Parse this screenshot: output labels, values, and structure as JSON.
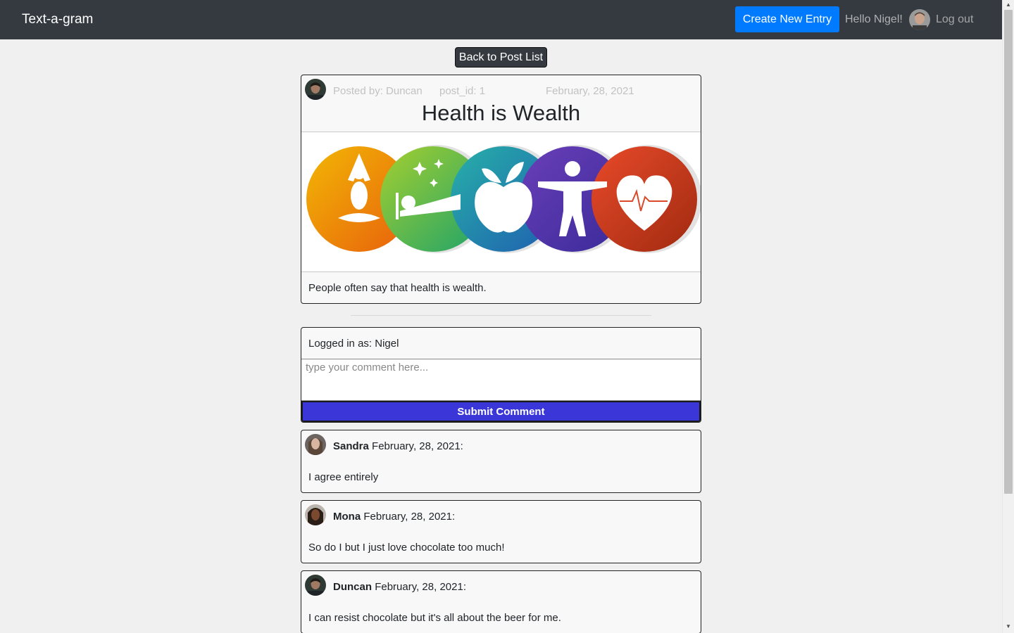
{
  "navbar": {
    "brand": "Text-a-gram",
    "new_entry_label": "Create New Entry",
    "greeting": "Hello Nigel!",
    "logout_label": "Log out"
  },
  "back_button_label": "Back to Post List",
  "post": {
    "author_label": "Posted by: Duncan",
    "post_id_label": "post_id: 1",
    "date": "February, 28, 2021",
    "title": "Health is Wealth",
    "body": "People often say that health is wealth."
  },
  "comment_form": {
    "logged_in_label": "Logged in as: Nigel",
    "placeholder": "type your comment here...",
    "submit_label": "Submit Comment"
  },
  "comments": [
    {
      "author": "Sandra",
      "date": "February, 28, 2021:",
      "text": "I agree entirely"
    },
    {
      "author": "Mona",
      "date": "February, 28, 2021:",
      "text": "So do I but I just love chocolate too much!"
    },
    {
      "author": "Duncan",
      "date": "February, 28, 2021:",
      "text": "I can resist chocolate but it's all about the beer for me."
    }
  ],
  "colors": {
    "navbar_bg": "#343a40",
    "primary": "#007bff",
    "submit_bg": "#3a36d8",
    "page_bg": "#f0f0f0"
  }
}
